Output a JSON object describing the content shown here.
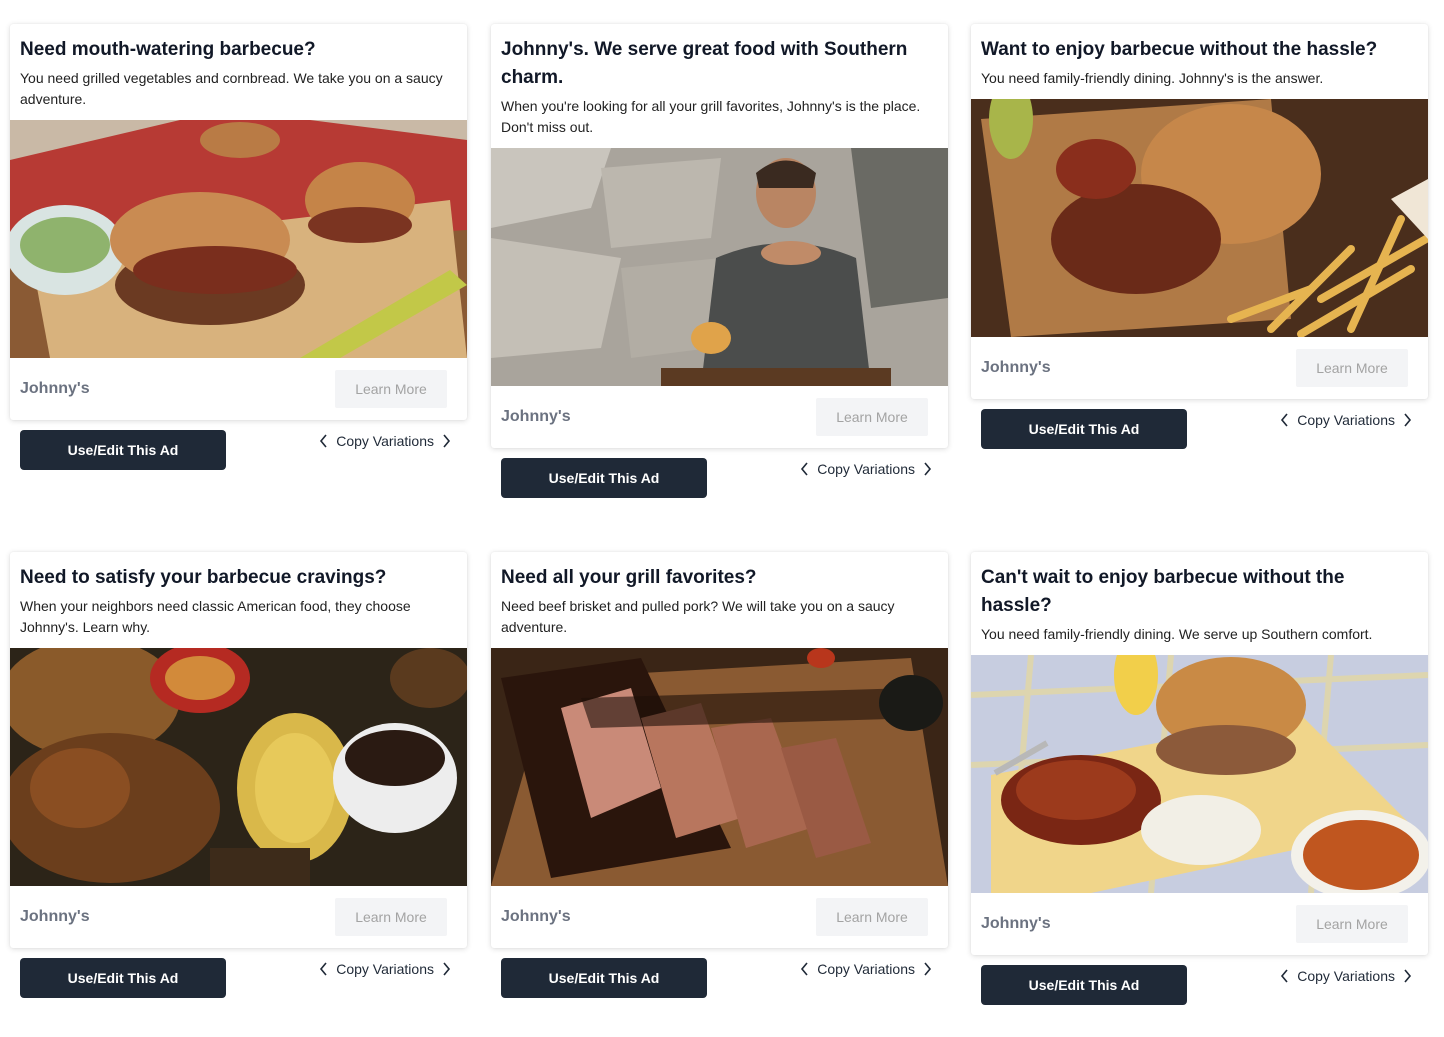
{
  "ads": [
    {
      "headline": "Need mouth-watering barbecue?",
      "description": "You need grilled vegetables and cornbread. We take you on a saucy adventure.",
      "image": "pulled-pork-sandwich-photo",
      "brand": "Johnny's",
      "cta": "Learn More",
      "use_label": "Use/Edit This Ad",
      "variations_label": "Copy Variations"
    },
    {
      "headline": "Johnny's. We serve great food with Southern charm.",
      "description": "When you're looking for all your grill favorites, Johnny's is the place. Don't miss out.",
      "image": "man-eating-ribs-photo",
      "brand": "Johnny's",
      "cta": "Learn More",
      "use_label": "Use/Edit This Ad",
      "variations_label": "Copy Variations"
    },
    {
      "headline": "Want to enjoy barbecue without the hassle?",
      "description": "You need family-friendly dining. Johnny's is the answer.",
      "image": "bbq-sandwich-fries-photo",
      "brand": "Johnny's",
      "cta": "Learn More",
      "use_label": "Use/Edit This Ad",
      "variations_label": "Copy Variations"
    },
    {
      "headline": "Need to satisfy your barbecue cravings?",
      "description": "When your neighbors need classic American food, they choose Johnny's. Learn why.",
      "image": "grilled-chicken-corn-photo",
      "brand": "Johnny's",
      "cta": "Learn More",
      "use_label": "Use/Edit This Ad",
      "variations_label": "Copy Variations"
    },
    {
      "headline": "Need all your grill favorites?",
      "description": "Need beef brisket and pulled pork? We will take you on a saucy adventure.",
      "image": "sliced-brisket-photo",
      "brand": "Johnny's",
      "cta": "Learn More",
      "use_label": "Use/Edit This Ad",
      "variations_label": "Copy Variations"
    },
    {
      "headline": "Can't wait to enjoy barbecue without the hassle?",
      "description": "You need family-friendly dining. We serve up Southern comfort.",
      "image": "bbq-platter-beans-slaw-photo",
      "brand": "Johnny's",
      "cta": "Learn More",
      "use_label": "Use/Edit This Ad",
      "variations_label": "Copy Variations"
    }
  ],
  "colors": {
    "button_dark": "#1f2937",
    "brand_text": "#6b7280",
    "learn_more_bg": "#f3f4f6"
  },
  "icons": {
    "prev": "chevron-left-icon",
    "next": "chevron-right-icon"
  }
}
